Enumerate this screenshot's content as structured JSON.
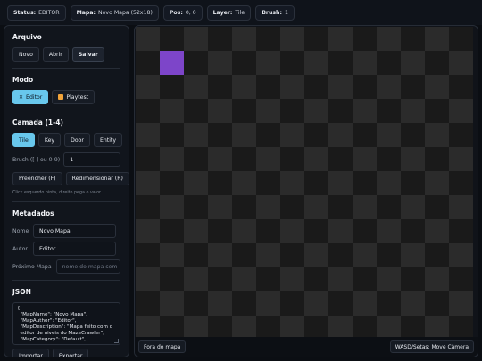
{
  "topbar": {
    "status": {
      "label": "Status:",
      "value": "EDITOR"
    },
    "map": {
      "label": "Mapa:",
      "value": "Novo Mapa (52x18)"
    },
    "pos": {
      "label": "Pos:",
      "value": "0, 0"
    },
    "layer": {
      "label": "Layer:",
      "value": "Tile"
    },
    "brush": {
      "label": "Brush:",
      "value": "1"
    }
  },
  "sidebar": {
    "arquivo": {
      "title": "Arquivo",
      "novo": "Novo",
      "abrir": "Abrir",
      "salvar": "Salvar"
    },
    "modo": {
      "title": "Modo",
      "editor": "Editor",
      "playtest": "Playtest",
      "editor_icon": "tools-icon",
      "playtest_icon": "play-icon"
    },
    "camada": {
      "title": "Camada (1-4)",
      "tabs": [
        "Tile",
        "Key",
        "Door",
        "Entity"
      ],
      "active": "Tile",
      "brush_label": "Brush ([ ] ou 0-9)",
      "brush_value": "1",
      "preencher": "Preencher (F)",
      "redimensionar": "Redimensionar (R)",
      "hint": "Click esquerdo pinta, direito pega o valor."
    },
    "metadados": {
      "title": "Metadados",
      "nome_label": "Nome",
      "nome_value": "Novo Mapa",
      "autor_label": "Autor",
      "autor_value": "Editor",
      "proximo_label": "Próximo Mapa",
      "proximo_placeholder": "nome do mapa sem .json"
    },
    "json": {
      "title": "JSON",
      "content": "{\n  \"MapName\": \"Novo Mapa\",\n  \"MapAuthor\": \"Editor\",\n  \"MapDescription\": \"Mapa feito com o\n  editor de niveis do MazeCrawler\",\n  \"MapCategory\": \"Default\",",
      "importar": "Importar",
      "exportar": "Exportar"
    }
  },
  "canvas": {
    "highlight_color": "#7d45c9",
    "dark_tile": "#1a1a1a",
    "light_tile": "#2b2b2b",
    "status_left": "Fora do mapa",
    "status_right": "WASD/Setas: Move Câmera"
  }
}
